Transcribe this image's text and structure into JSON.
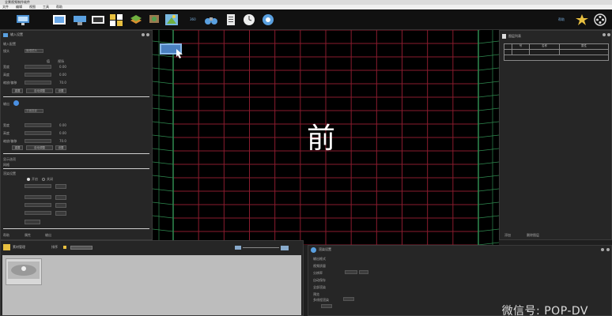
{
  "window": {
    "title": "全景视频制作软件"
  },
  "menu": [
    "文件",
    "编辑",
    "视图",
    "工具",
    "帮助"
  ],
  "toolbar": {
    "left_label": "",
    "mid_label": "360",
    "right_label": "帮助",
    "icons": [
      "monitor-add-icon",
      "tile-icon",
      "panorama-icon",
      "pano-viewer-icon",
      "grid-icon",
      "layers-icon",
      "paint-icon",
      "map-icon",
      "binoculars-icon",
      "clipboard-icon",
      "clock-icon",
      "video-settings-icon",
      "star-icon",
      "film-reel-icon"
    ]
  },
  "left_panel": {
    "title": "输入设置",
    "section1_title": "输入配置",
    "lens_label": "镜头",
    "lens_value": "鱼眼镜头",
    "col_a": "值",
    "col_b": "视场",
    "rows": [
      {
        "label": "宽度",
        "value": "",
        "num": "0.00"
      },
      {
        "label": "高度",
        "value": "",
        "num": "0.00"
      },
      {
        "label": "缩放/偏移",
        "value": "",
        "num": "70.0"
      }
    ],
    "btn1": "重置",
    "btn2": "自动调整",
    "btn3": "设置",
    "section2_title": "输出",
    "out_lens_value": "平面投影",
    "rows2": [
      {
        "label": "宽度",
        "value": "",
        "num": "0.00"
      },
      {
        "label": "高度",
        "value": "",
        "num": "0.00"
      },
      {
        "label": "缩放/偏移",
        "value": "",
        "num": "70.0"
      }
    ],
    "btn4": "重置",
    "btn5": "自动调整",
    "btn6": "设置",
    "section3_title": "显示选项",
    "section3_sub": "网格",
    "section4_title": "渲染设置",
    "opt1": "开启",
    "opt2": "关闭",
    "footer_items": [
      "帮助",
      "属性",
      "输出"
    ]
  },
  "viewport": {
    "center_text": "前",
    "cols": 12,
    "rows": 16,
    "grid_color": "#8a1c2e",
    "side_color": "#2f8a50"
  },
  "right_panel": {
    "title": "图层列表",
    "table_headers": [
      "",
      "号",
      "名称",
      "属性"
    ],
    "footer_items": [
      "添加",
      "删除图层"
    ]
  },
  "bottom_left": {
    "title": "素材管理",
    "sort_label": "排序"
  },
  "bottom_right": {
    "title": "渲染设置",
    "opts": [
      "输出格式",
      "视频质量",
      "分辨率",
      "自动保存",
      "全部渲染",
      "预览",
      "多线程渲染"
    ]
  },
  "watermark": "微信号: POP-DV"
}
